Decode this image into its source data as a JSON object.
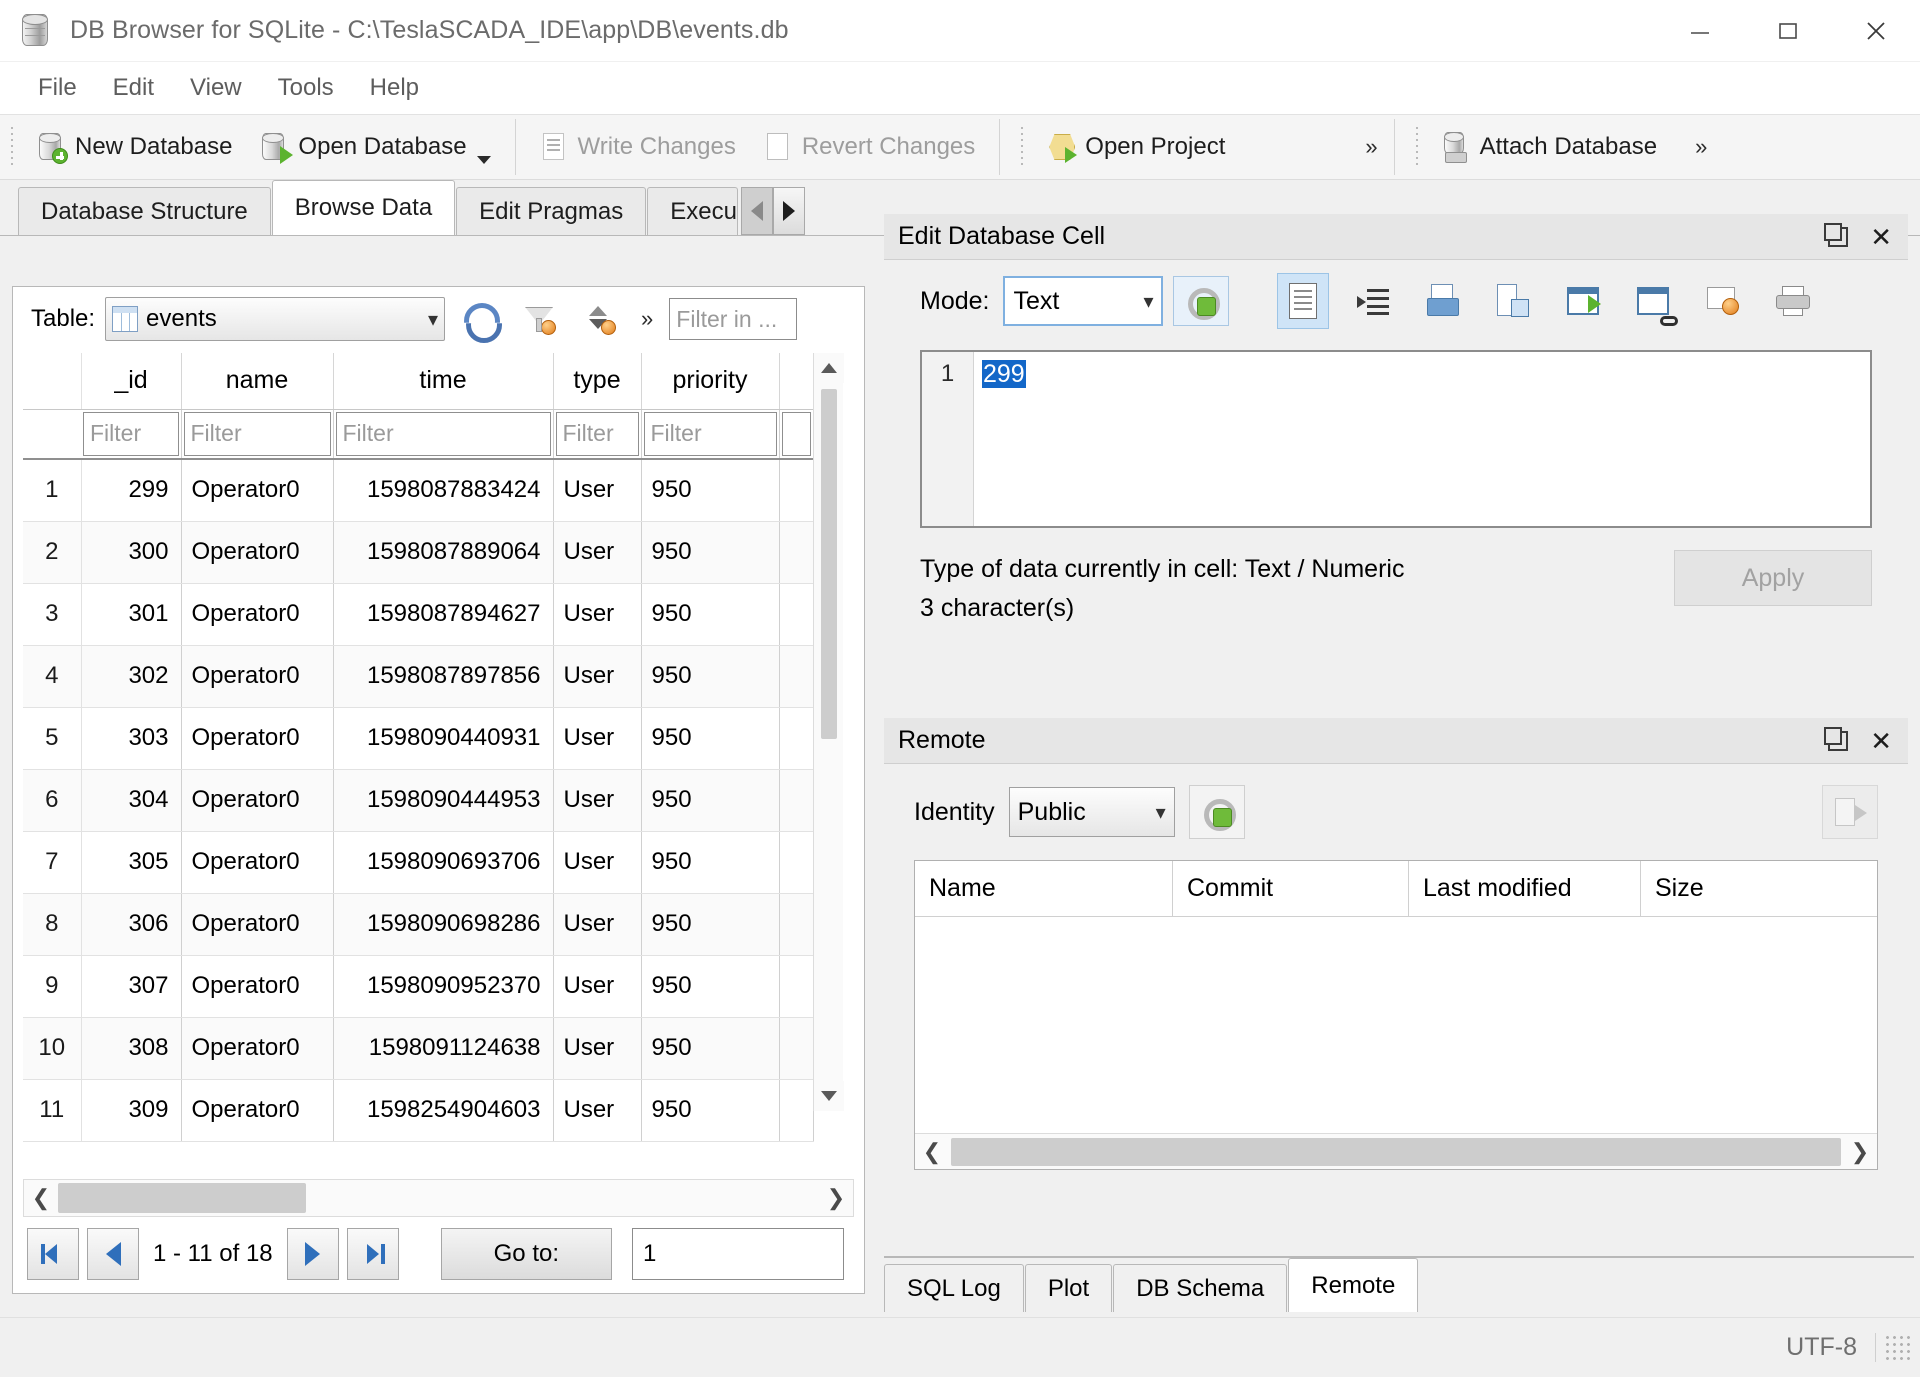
{
  "window": {
    "title": "DB Browser for SQLite - C:\\TeslaSCADA_IDE\\app\\DB\\events.db",
    "icon": "database-icon",
    "controls": {
      "minimize": "minimize-icon",
      "maximize": "maximize-icon",
      "close": "close-icon"
    }
  },
  "menu": {
    "items": [
      "File",
      "Edit",
      "View",
      "Tools",
      "Help"
    ]
  },
  "toolbar": {
    "buttons": [
      {
        "label": "New Database",
        "icon": "new-database-icon",
        "disabled": false
      },
      {
        "label": "Open Database",
        "icon": "open-database-icon",
        "disabled": false,
        "has_dropdown": true
      },
      {
        "label": "Write Changes",
        "icon": "write-changes-icon",
        "disabled": true
      },
      {
        "label": "Revert Changes",
        "icon": "revert-changes-icon",
        "disabled": true
      },
      {
        "label": "Open Project",
        "icon": "open-project-icon",
        "disabled": false
      },
      {
        "label": "Attach Database",
        "icon": "attach-database-icon",
        "disabled": false
      }
    ],
    "overflow_glyph": "»"
  },
  "tabs": {
    "items": [
      "Database Structure",
      "Browse Data",
      "Edit Pragmas",
      "Execu"
    ],
    "active": "Browse Data",
    "scroll_left_icon": "tab-scroll-left-icon",
    "scroll_right_icon": "tab-scroll-right-icon"
  },
  "browse": {
    "table_label": "Table:",
    "table_value": "events",
    "table_icon": "table-grid-icon",
    "refresh_icon": "refresh-icon",
    "filter_icon": "clear-filters-icon",
    "sort_icon": "clear-sort-icon",
    "overflow_glyph": "»",
    "filter_in_placeholder": "Filter in ...",
    "columns": [
      "_id",
      "name",
      "time",
      "type",
      "priority"
    ],
    "filter_placeholder": "Filter",
    "rows": [
      {
        "n": "1",
        "_id": "299",
        "name": "Operator0",
        "time": "1598087883424",
        "type": "User",
        "priority": "950"
      },
      {
        "n": "2",
        "_id": "300",
        "name": "Operator0",
        "time": "1598087889064",
        "type": "User",
        "priority": "950"
      },
      {
        "n": "3",
        "_id": "301",
        "name": "Operator0",
        "time": "1598087894627",
        "type": "User",
        "priority": "950"
      },
      {
        "n": "4",
        "_id": "302",
        "name": "Operator0",
        "time": "1598087897856",
        "type": "User",
        "priority": "950"
      },
      {
        "n": "5",
        "_id": "303",
        "name": "Operator0",
        "time": "1598090440931",
        "type": "User",
        "priority": "950"
      },
      {
        "n": "6",
        "_id": "304",
        "name": "Operator0",
        "time": "1598090444953",
        "type": "User",
        "priority": "950"
      },
      {
        "n": "7",
        "_id": "305",
        "name": "Operator0",
        "time": "1598090693706",
        "type": "User",
        "priority": "950"
      },
      {
        "n": "8",
        "_id": "306",
        "name": "Operator0",
        "time": "1598090698286",
        "type": "User",
        "priority": "950"
      },
      {
        "n": "9",
        "_id": "307",
        "name": "Operator0",
        "time": "1598090952370",
        "type": "User",
        "priority": "950"
      },
      {
        "n": "10",
        "_id": "308",
        "name": "Operator0",
        "time": "1598091124638",
        "type": "User",
        "priority": "950"
      },
      {
        "n": "11",
        "_id": "309",
        "name": "Operator0",
        "time": "1598254904603",
        "type": "User",
        "priority": "950"
      }
    ],
    "pager": {
      "first_icon": "go-first-icon",
      "prev_icon": "go-previous-icon",
      "range": "1 - 11 of 18",
      "next_icon": "go-next-icon",
      "last_icon": "go-last-icon",
      "goto_label": "Go to:",
      "goto_value": "1"
    }
  },
  "edit_cell": {
    "title": "Edit Database Cell",
    "float_icon": "float-dock-icon",
    "close_icon": "close-icon",
    "mode_label": "Mode:",
    "mode_value": "Text",
    "auto_switch_icon": "auto-switch-mode-icon",
    "actions": [
      {
        "icon": "text-mode-icon",
        "selected": true
      },
      {
        "icon": "word-wrap-icon",
        "selected": false
      },
      {
        "icon": "import-data-icon",
        "selected": false
      },
      {
        "icon": "export-data-icon",
        "selected": false
      },
      {
        "icon": "open-in-external-app-icon",
        "selected": false
      },
      {
        "icon": "open-in-default-app-icon",
        "selected": false
      },
      {
        "icon": "set-as-null-icon",
        "selected": false
      },
      {
        "icon": "print-icon",
        "selected": false
      }
    ],
    "line_number": "1",
    "content": "299",
    "type_info": "Type of data currently in cell: Text / Numeric",
    "char_info": "3 character(s)",
    "apply_label": "Apply",
    "apply_disabled": true
  },
  "remote": {
    "title": "Remote",
    "float_icon": "float-dock-icon",
    "close_icon": "close-icon",
    "identity_label": "Identity",
    "identity_value": "Public",
    "identity_settings_icon": "remote-settings-icon",
    "push_icon": "push-database-icon",
    "columns": [
      "Name",
      "Commit",
      "Last modified",
      "Size"
    ],
    "rows": []
  },
  "bottom_tabs": {
    "items": [
      "SQL Log",
      "Plot",
      "DB Schema",
      "Remote"
    ],
    "active": "Remote"
  },
  "statusbar": {
    "encoding": "UTF-8",
    "sizegrip_icon": "resize-grip-icon"
  },
  "colors": {
    "accent_blue": "#1367c8",
    "selection_blue": "#cfe4f7",
    "window_bg": "#f0f0f0",
    "panel_bg": "#ffffff",
    "green": "#5cb32f",
    "orange": "#e07b18"
  }
}
